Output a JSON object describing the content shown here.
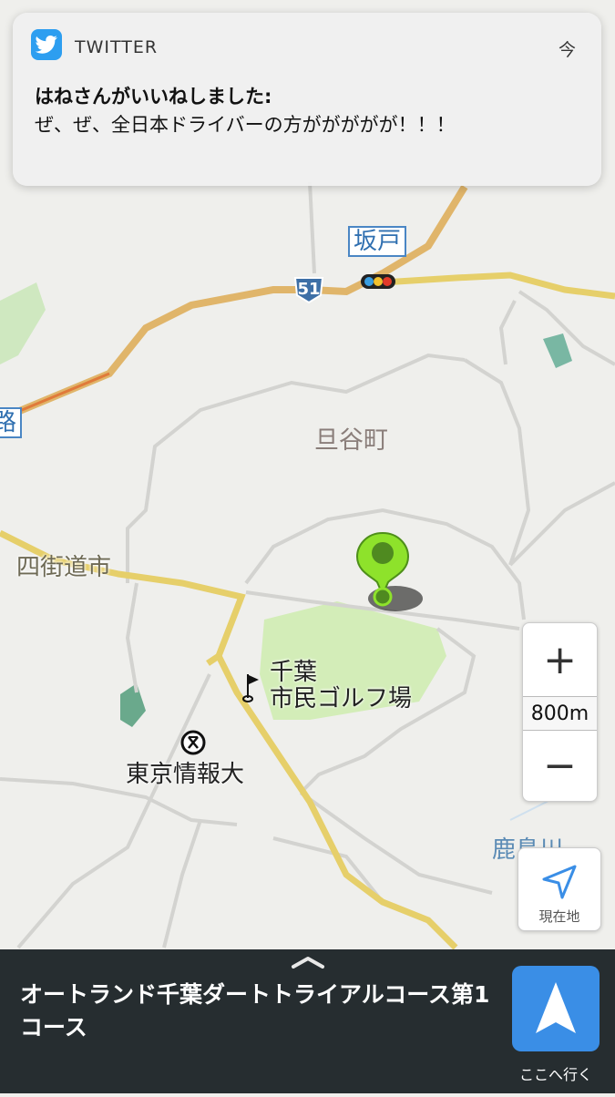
{
  "notification": {
    "app": "TWITTER",
    "time": "今",
    "title": "はねさんがいいねしました:",
    "body": "ぜ、ぜ、全日本ドライバーの方ががががが！！！"
  },
  "map": {
    "labels": {
      "sakado": "坂戸",
      "route_number": "51",
      "edge_road": "路",
      "tanyacho": "旦谷町",
      "yotsukaido": "四街道市",
      "golf_line1": "千葉",
      "golf_line2": "市民ゴルフ場",
      "university": "東京情報大",
      "kashimagawa": "鹿島川"
    },
    "icons": {
      "pin": "green-location-pin",
      "flag": "golf-flag-icon",
      "school": "school-symbol-icon",
      "traffic": "traffic-light-icon"
    },
    "colors": {
      "pin": "#8ee22b",
      "road_major": "#e0b56a",
      "road_yellow": "#e6cf6a",
      "park": "#d3edb8"
    }
  },
  "controls": {
    "zoom_in": "+",
    "zoom_out": "−",
    "scale": "800m",
    "locate_label": "現在地"
  },
  "bottom": {
    "destination": "オートランド千葉ダートトライアルコース第1コース",
    "navigate_label": "ここへ行く"
  }
}
